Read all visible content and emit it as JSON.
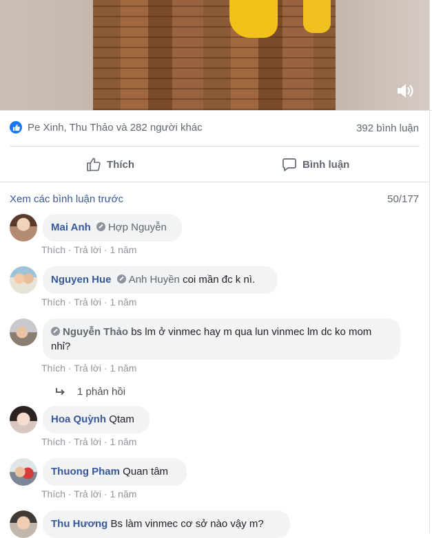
{
  "post": {
    "reactions_text": "Pe Xinh, Thu Thảo và 282 người khác",
    "comment_count": "392 bình luận",
    "like_label": "Thích",
    "comment_label": "Bình luận"
  },
  "comments_header": {
    "previous_link": "Xem các bình luận trước",
    "page_count": "50/177"
  },
  "comments": [
    {
      "author": "Mai Anh",
      "tag": "Hợp Nguyễn",
      "text": "",
      "like": "Thích",
      "reply": "Trả lời",
      "time": "1 năm"
    },
    {
      "author": "Nguyen Hue",
      "tag": "Anh Huyền",
      "text": "coi mần đc k nì.",
      "like": "Thích",
      "reply": "Trả lời",
      "time": "1 năm"
    },
    {
      "author": "",
      "tag": "Nguyễn Thảo",
      "text": "bs lm ở vinmec hay m qua lun vinmec lm dc ko mom nhỉ?",
      "like": "Thích",
      "reply": "Trả lời",
      "time": "1 năm",
      "replies": "1 phản hồi"
    },
    {
      "author": "Hoa Quỳnh",
      "tag": "",
      "text": "Qtam",
      "like": "Thích",
      "reply": "Trả lời",
      "time": "1 năm"
    },
    {
      "author": "Thuong Pham",
      "tag": "",
      "text": "Quan tâm",
      "like": "Thích",
      "reply": "Trả lời",
      "time": "1 năm"
    },
    {
      "author": "Thu Hương",
      "tag": "",
      "text": "Bs làm vinmec cơ sở nào vậy m?",
      "like": "",
      "reply": "",
      "time": ""
    }
  ],
  "separator": "·",
  "icons": {
    "volume": "volume-icon",
    "like_badge": "like-badge-icon",
    "thumb": "thumbs-up-icon",
    "comment": "comment-bubble-icon",
    "reply_arrow": "reply-arrow-icon"
  },
  "colors": {
    "link": "#385898",
    "accent": "#1877f2",
    "muted": "#606770"
  }
}
